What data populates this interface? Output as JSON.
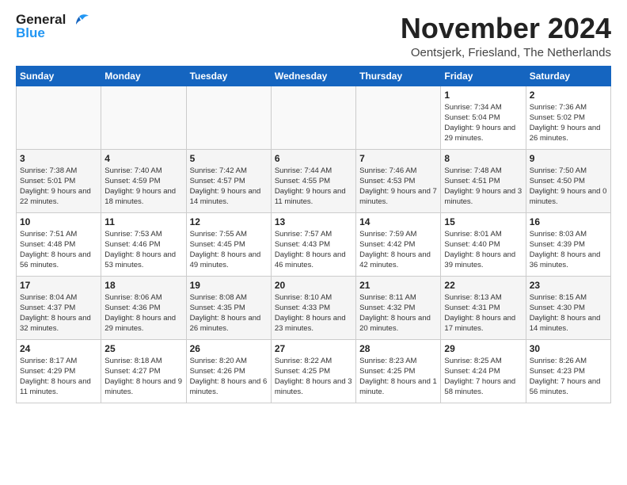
{
  "header": {
    "logo": {
      "general": "General",
      "blue": "Blue"
    },
    "title": "November 2024",
    "location": "Oentsjerk, Friesland, The Netherlands"
  },
  "calendar": {
    "days_of_week": [
      "Sunday",
      "Monday",
      "Tuesday",
      "Wednesday",
      "Thursday",
      "Friday",
      "Saturday"
    ],
    "weeks": [
      [
        {
          "day": "",
          "info": ""
        },
        {
          "day": "",
          "info": ""
        },
        {
          "day": "",
          "info": ""
        },
        {
          "day": "",
          "info": ""
        },
        {
          "day": "",
          "info": ""
        },
        {
          "day": "1",
          "info": "Sunrise: 7:34 AM\nSunset: 5:04 PM\nDaylight: 9 hours and 29 minutes."
        },
        {
          "day": "2",
          "info": "Sunrise: 7:36 AM\nSunset: 5:02 PM\nDaylight: 9 hours and 26 minutes."
        }
      ],
      [
        {
          "day": "3",
          "info": "Sunrise: 7:38 AM\nSunset: 5:01 PM\nDaylight: 9 hours and 22 minutes."
        },
        {
          "day": "4",
          "info": "Sunrise: 7:40 AM\nSunset: 4:59 PM\nDaylight: 9 hours and 18 minutes."
        },
        {
          "day": "5",
          "info": "Sunrise: 7:42 AM\nSunset: 4:57 PM\nDaylight: 9 hours and 14 minutes."
        },
        {
          "day": "6",
          "info": "Sunrise: 7:44 AM\nSunset: 4:55 PM\nDaylight: 9 hours and 11 minutes."
        },
        {
          "day": "7",
          "info": "Sunrise: 7:46 AM\nSunset: 4:53 PM\nDaylight: 9 hours and 7 minutes."
        },
        {
          "day": "8",
          "info": "Sunrise: 7:48 AM\nSunset: 4:51 PM\nDaylight: 9 hours and 3 minutes."
        },
        {
          "day": "9",
          "info": "Sunrise: 7:50 AM\nSunset: 4:50 PM\nDaylight: 9 hours and 0 minutes."
        }
      ],
      [
        {
          "day": "10",
          "info": "Sunrise: 7:51 AM\nSunset: 4:48 PM\nDaylight: 8 hours and 56 minutes."
        },
        {
          "day": "11",
          "info": "Sunrise: 7:53 AM\nSunset: 4:46 PM\nDaylight: 8 hours and 53 minutes."
        },
        {
          "day": "12",
          "info": "Sunrise: 7:55 AM\nSunset: 4:45 PM\nDaylight: 8 hours and 49 minutes."
        },
        {
          "day": "13",
          "info": "Sunrise: 7:57 AM\nSunset: 4:43 PM\nDaylight: 8 hours and 46 minutes."
        },
        {
          "day": "14",
          "info": "Sunrise: 7:59 AM\nSunset: 4:42 PM\nDaylight: 8 hours and 42 minutes."
        },
        {
          "day": "15",
          "info": "Sunrise: 8:01 AM\nSunset: 4:40 PM\nDaylight: 8 hours and 39 minutes."
        },
        {
          "day": "16",
          "info": "Sunrise: 8:03 AM\nSunset: 4:39 PM\nDaylight: 8 hours and 36 minutes."
        }
      ],
      [
        {
          "day": "17",
          "info": "Sunrise: 8:04 AM\nSunset: 4:37 PM\nDaylight: 8 hours and 32 minutes."
        },
        {
          "day": "18",
          "info": "Sunrise: 8:06 AM\nSunset: 4:36 PM\nDaylight: 8 hours and 29 minutes."
        },
        {
          "day": "19",
          "info": "Sunrise: 8:08 AM\nSunset: 4:35 PM\nDaylight: 8 hours and 26 minutes."
        },
        {
          "day": "20",
          "info": "Sunrise: 8:10 AM\nSunset: 4:33 PM\nDaylight: 8 hours and 23 minutes."
        },
        {
          "day": "21",
          "info": "Sunrise: 8:11 AM\nSunset: 4:32 PM\nDaylight: 8 hours and 20 minutes."
        },
        {
          "day": "22",
          "info": "Sunrise: 8:13 AM\nSunset: 4:31 PM\nDaylight: 8 hours and 17 minutes."
        },
        {
          "day": "23",
          "info": "Sunrise: 8:15 AM\nSunset: 4:30 PM\nDaylight: 8 hours and 14 minutes."
        }
      ],
      [
        {
          "day": "24",
          "info": "Sunrise: 8:17 AM\nSunset: 4:29 PM\nDaylight: 8 hours and 11 minutes."
        },
        {
          "day": "25",
          "info": "Sunrise: 8:18 AM\nSunset: 4:27 PM\nDaylight: 8 hours and 9 minutes."
        },
        {
          "day": "26",
          "info": "Sunrise: 8:20 AM\nSunset: 4:26 PM\nDaylight: 8 hours and 6 minutes."
        },
        {
          "day": "27",
          "info": "Sunrise: 8:22 AM\nSunset: 4:25 PM\nDaylight: 8 hours and 3 minutes."
        },
        {
          "day": "28",
          "info": "Sunrise: 8:23 AM\nSunset: 4:25 PM\nDaylight: 8 hours and 1 minute."
        },
        {
          "day": "29",
          "info": "Sunrise: 8:25 AM\nSunset: 4:24 PM\nDaylight: 7 hours and 58 minutes."
        },
        {
          "day": "30",
          "info": "Sunrise: 8:26 AM\nSunset: 4:23 PM\nDaylight: 7 hours and 56 minutes."
        }
      ]
    ]
  }
}
